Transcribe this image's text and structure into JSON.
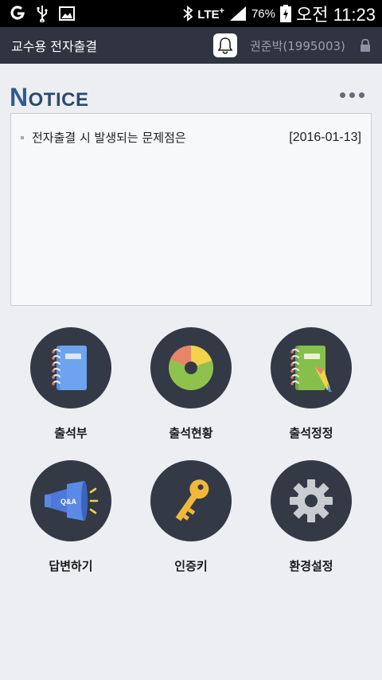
{
  "statusbar": {
    "lte": "LTE",
    "lte_plus": "+",
    "battery_pct": "76%",
    "time": "오전 11:23"
  },
  "appbar": {
    "title": "교수용 전자출결",
    "user": "권준박(1995003)"
  },
  "notice": {
    "title_initial": "N",
    "title_rest": "OTICE",
    "items": [
      {
        "text": "전자출결 시 발생되는 문제점은",
        "date": "[2016-01-13]"
      }
    ]
  },
  "menu": [
    {
      "label": "출석부",
      "icon": "notebook-icon"
    },
    {
      "label": "출석현황",
      "icon": "donut-chart-icon"
    },
    {
      "label": "출석정정",
      "icon": "edit-notebook-icon"
    },
    {
      "label": "답변하기",
      "icon": "megaphone-qa-icon"
    },
    {
      "label": "인증키",
      "icon": "key-icon"
    },
    {
      "label": "환경설정",
      "icon": "gear-icon"
    }
  ]
}
